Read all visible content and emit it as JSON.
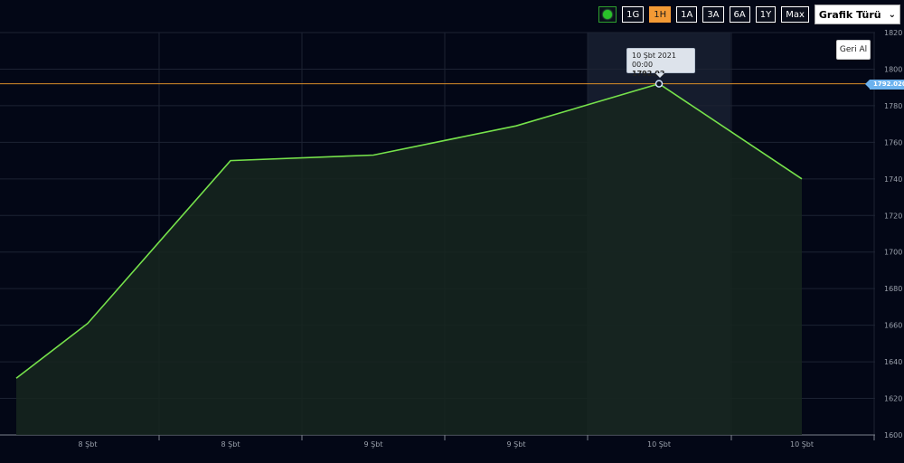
{
  "toolbar": {
    "live_icon": "live-status-icon",
    "ranges": [
      "1G",
      "1H",
      "1A",
      "3A",
      "6A",
      "1Y",
      "Max"
    ],
    "active_range": "1H",
    "chart_type_label": "Grafik Türü",
    "chart_type_icon": "chevron-down-icon"
  },
  "reset_zoom_label": "Geri Al",
  "tooltip": {
    "date": "10 Şbt 2021 00:00",
    "value": "1792.02"
  },
  "current_price_label": "1792.0200",
  "colors": {
    "line": "#76e24b",
    "price_line": "#d88e28",
    "background": "#030716",
    "active_button": "#f39a35"
  },
  "chart_data": {
    "type": "area",
    "x": [
      "8 Şbt",
      "8 Şbt",
      "9 Şbt",
      "9 Şbt",
      "10 Şbt",
      "10 Şbt"
    ],
    "x_tick_labels": [
      "8 Şbt",
      "8 Şbt",
      "9 Şbt",
      "9 Şbt",
      "10 Şbt",
      "10 Şbt"
    ],
    "y_tick_labels": [
      "1600",
      "1620",
      "1640",
      "1660",
      "1680",
      "1700",
      "1720",
      "1740",
      "1760",
      "1780",
      "1800",
      "1820"
    ],
    "points": [
      {
        "i": 0.0,
        "y": 1631
      },
      {
        "i": 0.5,
        "y": 1661
      },
      {
        "i": 1.5,
        "y": 1750
      },
      {
        "i": 2.5,
        "y": 1753
      },
      {
        "i": 3.5,
        "y": 1769
      },
      {
        "i": 4.5,
        "y": 1792.02
      },
      {
        "i": 5.5,
        "y": 1740
      }
    ],
    "hover_index": 5,
    "current_price": 1792.02,
    "ylim": [
      1600,
      1820
    ],
    "grid": true,
    "title": "",
    "xlabel": "",
    "ylabel": ""
  }
}
